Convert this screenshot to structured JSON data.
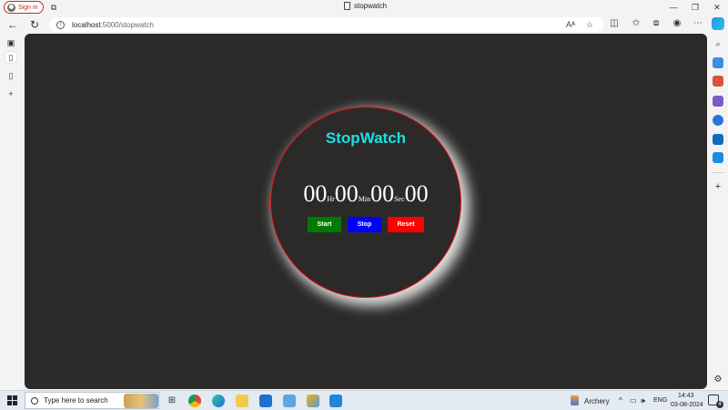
{
  "browser": {
    "signin_label": "Sign in",
    "tab_title": "stopwatch",
    "url_host": "localhost",
    "url_path": ":5000/stopwatch",
    "window_controls": [
      "—",
      "❐",
      "✕"
    ]
  },
  "page": {
    "title": "StopWatch",
    "hours": "00",
    "hours_unit": "Hr",
    "minutes": "00",
    "minutes_unit": "Min",
    "seconds": "00",
    "seconds_unit": "Sec",
    "centis": "00",
    "start_label": "Start",
    "stop_label": "Stop",
    "reset_label": "Reset",
    "colors": {
      "background": "#2b2a29",
      "title": "#19e0e6",
      "border": "#ee1111",
      "start": "#007a00",
      "stop": "#0000ff",
      "reset": "#ff0000"
    }
  },
  "taskbar": {
    "search_placeholder": "Type here to search",
    "weather_label": "Archery",
    "language": "ENG",
    "time": "14:43",
    "date": "03-08-2024",
    "notification_count": "4"
  }
}
